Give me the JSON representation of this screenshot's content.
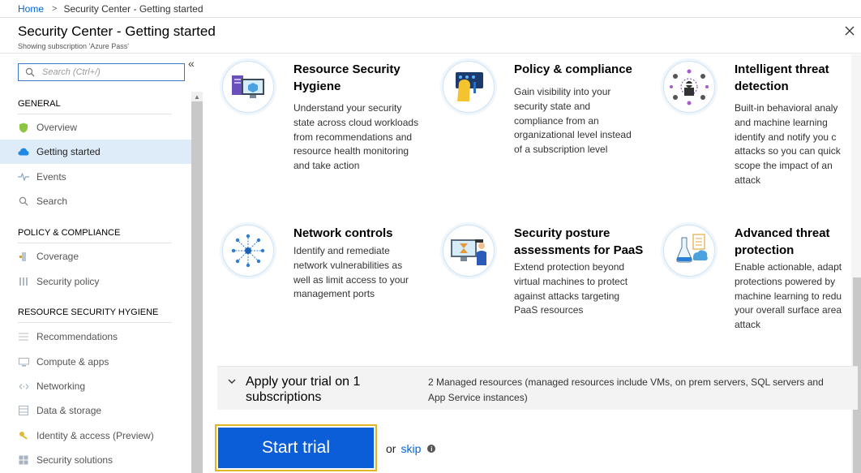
{
  "breadcrumb": {
    "home": "Home",
    "separator": ">",
    "current": "Security Center - Getting started"
  },
  "header": {
    "title": "Security Center - Getting started",
    "subtitle": "Showing subscription 'Azure Pass'"
  },
  "sidebar": {
    "collapse_glyph": "«",
    "search_placeholder": "Search (Ctrl+/)",
    "sections": [
      {
        "label": "GENERAL",
        "items": [
          {
            "label": "Overview",
            "icon": "shield-icon"
          },
          {
            "label": "Getting started",
            "icon": "cloud-icon",
            "active": true
          },
          {
            "label": "Events",
            "icon": "pulse-icon"
          },
          {
            "label": "Search",
            "icon": "search-icon"
          }
        ]
      },
      {
        "label": "POLICY & COMPLIANCE",
        "items": [
          {
            "label": "Coverage",
            "icon": "coverage-icon"
          },
          {
            "label": "Security policy",
            "icon": "policy-icon"
          }
        ]
      },
      {
        "label": "RESOURCE SECURITY HYGIENE",
        "items": [
          {
            "label": "Recommendations",
            "icon": "list-icon"
          },
          {
            "label": "Compute & apps",
            "icon": "compute-icon"
          },
          {
            "label": "Networking",
            "icon": "network-icon"
          },
          {
            "label": "Data & storage",
            "icon": "storage-icon"
          },
          {
            "label": "Identity & access (Preview)",
            "icon": "key-icon"
          },
          {
            "label": "Security solutions",
            "icon": "solutions-icon"
          }
        ]
      }
    ]
  },
  "features": [
    {
      "title_lines": [
        "Resource Security",
        "Hygiene"
      ],
      "desc_lines": [
        "Understand your security",
        "state across cloud workloads",
        "from recommendations and",
        "resource health monitoring",
        "and take action"
      ],
      "icon": "resource-hygiene-icon"
    },
    {
      "title_lines": [
        "Policy & compliance"
      ],
      "desc_lines": [
        "Gain visibility into your",
        "security state and",
        "compliance from an",
        "organizational level instead",
        "of a subscription level"
      ],
      "icon": "policy-compliance-icon"
    },
    {
      "title_lines": [
        "Intelligent threat",
        "detection"
      ],
      "desc_lines": [
        "Built-in behavioral analy",
        "and machine learning",
        "identify and notify you c",
        "attacks so you can quick",
        "scope the impact of an",
        "attack"
      ],
      "icon": "threat-detection-icon"
    },
    {
      "title_lines": [
        "Network controls"
      ],
      "desc_lines": [
        "Identify and remediate",
        "network vulnerabilities as",
        "well as limit access to your",
        "management ports"
      ],
      "icon": "network-controls-icon"
    },
    {
      "title_lines": [
        "Security posture",
        "assessments for PaaS"
      ],
      "desc_lines": [
        "Extend protection beyond",
        "virtual machines to protect",
        "against attacks targeting",
        "PaaS resources"
      ],
      "icon": "posture-assessment-icon"
    },
    {
      "title_lines": [
        "Advanced threat",
        "protection"
      ],
      "desc_lines": [
        "Enable actionable, adapt",
        "protections powered by",
        "machine learning to redu",
        "your overall surface area",
        "attack"
      ],
      "icon": "threat-protection-icon"
    }
  ],
  "trial": {
    "title_lines": [
      "Apply your trial on 1",
      "subscriptions"
    ],
    "desc_lines": [
      "2 Managed resources (managed resources include VMs, on prem servers, SQL servers and",
      "App Service instances)"
    ]
  },
  "actions": {
    "start_label": "Start trial",
    "or": "or",
    "skip": "skip",
    "info_glyph": "i"
  },
  "colors": {
    "accent": "#0b5ed7",
    "focus_border": "#e4b528",
    "active_bg": "#deecf9",
    "link": "#0366d6"
  }
}
